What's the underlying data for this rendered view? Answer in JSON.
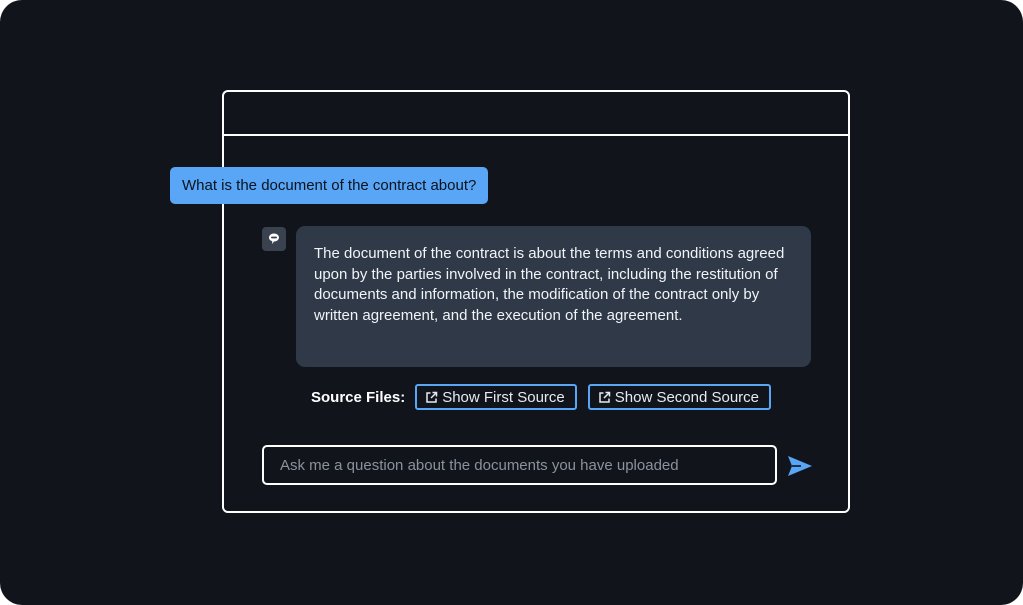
{
  "chat": {
    "user_message": "What is the document of the contract about?",
    "bot_response": "The document of the contract is about the terms and conditions agreed upon by the parties involved in the contract, including the restitution of documents and information, the modification of the contract only by written agreement, and the execution of the agreement."
  },
  "sources": {
    "label": "Source Files:",
    "buttons": [
      {
        "label": "Show First Source",
        "icon": "external-link-icon"
      },
      {
        "label": "Show Second Source",
        "icon": "external-link-icon"
      }
    ]
  },
  "input": {
    "placeholder": "Ask me a question about the documents you have uploaded",
    "value": ""
  },
  "icons": {
    "bot_avatar": "chat-bot-icon",
    "send": "send-icon"
  },
  "colors": {
    "background": "#11151b",
    "accent": "#58a6f5",
    "bot_bubble": "#2f3947",
    "window_border": "#ffffff"
  }
}
